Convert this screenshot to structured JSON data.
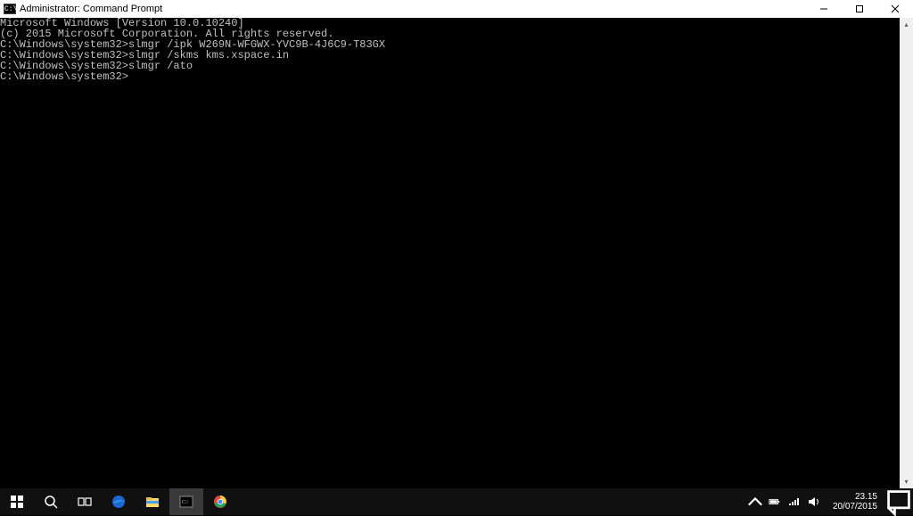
{
  "window": {
    "title": "Administrator: Command Prompt",
    "icon_label": "C:\\"
  },
  "terminal": {
    "lines": [
      "Microsoft Windows [Version 10.0.10240]",
      "(c) 2015 Microsoft Corporation. All rights reserved.",
      "",
      "C:\\Windows\\system32>slmgr /ipk W269N-WFGWX-YVC9B-4J6C9-T83GX",
      "",
      "C:\\Windows\\system32>slmgr /skms kms.xspace.in",
      "",
      "C:\\Windows\\system32>slmgr /ato",
      "",
      "C:\\Windows\\system32>"
    ]
  },
  "taskbar": {
    "items": [
      {
        "name": "start",
        "icon": "windows"
      },
      {
        "name": "search",
        "icon": "search"
      },
      {
        "name": "taskview",
        "icon": "taskview"
      },
      {
        "name": "edge",
        "icon": "edge"
      },
      {
        "name": "explorer",
        "icon": "explorer"
      },
      {
        "name": "cmd",
        "icon": "cmd",
        "active": true
      },
      {
        "name": "chrome",
        "icon": "chrome"
      }
    ]
  },
  "systray": {
    "time": "23.15",
    "date": "20/07/2015"
  }
}
